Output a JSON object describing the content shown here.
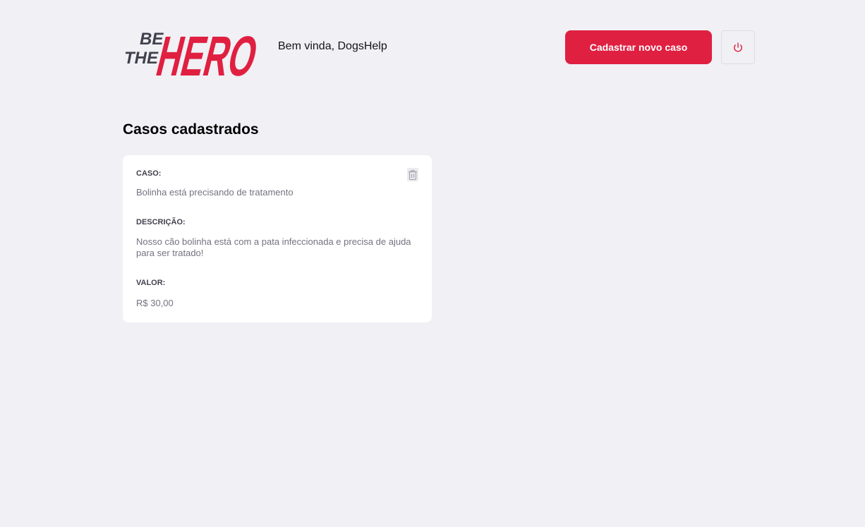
{
  "header": {
    "logo_text_top": "BE",
    "logo_text_mid": "THE",
    "logo_text_big": "HERO",
    "welcome": "Bem vinda, DogsHelp",
    "new_case_button": "Cadastrar novo caso",
    "logout_icon": "power-icon"
  },
  "main": {
    "title": "Casos cadastrados",
    "cases": [
      {
        "case_label": "CASO:",
        "case_value": "Bolinha está precisando de tratamento",
        "description_label": "DESCRIÇÃO:",
        "description_value": "Nosso cão bolinha está com a pata infeccionada e precisa de ajuda para ser tratado!",
        "value_label": "VALOR:",
        "value_value": "R$ 30,00",
        "delete_icon": "trash-icon"
      }
    ]
  },
  "colors": {
    "background": "#f0f0f5",
    "accent": "#e02041",
    "dark": "#41414d",
    "muted": "#737380"
  }
}
